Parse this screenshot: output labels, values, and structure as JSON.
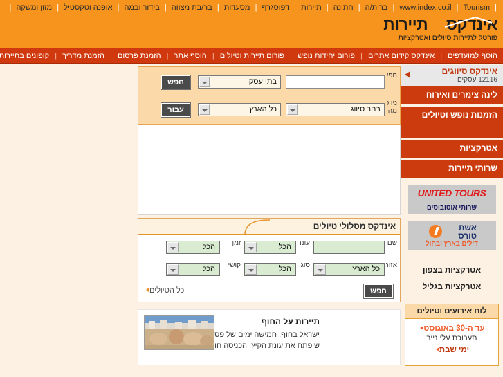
{
  "topnav": {
    "items": [
      "www.index.co.il",
      "Tourism",
      "ברית/ה",
      "חתונה",
      "תיירות",
      "דפוסגרף",
      "מסעדות",
      "בר/בת מצווה",
      "בידור ובמה",
      "אופנה וטקסטיל",
      "מזון ומשקה"
    ]
  },
  "logo": {
    "brand": "אינדקס",
    "section": "תיירות",
    "tagline": "פורטל לתיירות סיולים ואטרקציות"
  },
  "redbar": {
    "items": [
      "הוסף למועדפים",
      "אינדקס קידום אתרים",
      "פורום יחידות נופש",
      "פורום תיירות וטיולים",
      "הוסף אתר",
      "הזמנת פרסום",
      "הזמנת מדריך",
      "קופונים בתיירות"
    ]
  },
  "search": {
    "row1": {
      "label": "חפש",
      "button": "חפש",
      "category": "בתי עסק",
      "query": "",
      "query_placeholder": ""
    },
    "row2": {
      "label": "ניווט מהיר",
      "button": "עבור",
      "region": "כל הארץ",
      "classification": "בחר סיווג"
    }
  },
  "trips": {
    "title": "אינדקס מסלולי טיולים",
    "fields": {
      "name_label": "שם",
      "name_value": "",
      "season_label": "עונה",
      "season_value": "הכל",
      "time_label": "זמן",
      "time_value": "הכל",
      "area_label": "אזור",
      "area_value": "כל הארץ",
      "type_label": "סוג",
      "type_value": "הכל",
      "difficulty_label": "קושי",
      "difficulty_value": "הכל"
    },
    "search_button": "חפש",
    "all_link": "כל הטיולים"
  },
  "article": {
    "title": "תיירות על החוף",
    "body": "ישראל בחוף: חמישה ימים של פסטיבל חופים ענק, שיפתח את עונת הקיץ. הכניסה חופשית"
  },
  "sidebar": {
    "header": {
      "title": "אינדקס סיווגים",
      "subtitle": "12116 עסקים"
    },
    "items": [
      {
        "label": "לינה צימרים ואירוח"
      },
      {
        "label": "הזמנות נופש וטיולים"
      },
      {
        "label": "אטרקציות"
      },
      {
        "label": "שרותי תיירות"
      }
    ],
    "banners": [
      {
        "logo": "UNITED TOURS",
        "subtitle": "שרותי אוטובוסים"
      },
      {
        "logo_line1": "אשת",
        "logo_line2": "טורס",
        "subtitle": "דילים בארץ ובחול"
      }
    ],
    "links": [
      "אטרקציות בצפון",
      "אטרקציות בגליל"
    ],
    "events": {
      "title": "לוח אירועים וטיולים",
      "date": "עד ה-30 באוגוסט",
      "description": "תערוכת עלי נייר",
      "second_title": "ימי שבת"
    }
  },
  "colors": {
    "orange": "#f7941e",
    "red": "#cb3b0d",
    "peach": "#fbd9a9",
    "green_field": "#d9ecd2"
  }
}
